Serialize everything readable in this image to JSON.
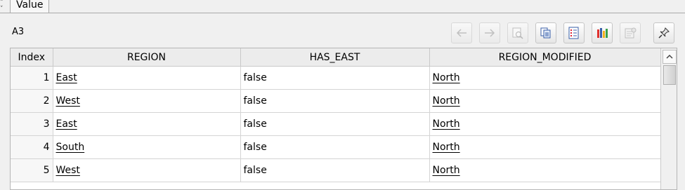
{
  "tab": {
    "label": "Value"
  },
  "cell_ref": "A3",
  "toolbar": {
    "buttons": [
      {
        "icon": "arrow-left-icon",
        "enabled": false
      },
      {
        "icon": "arrow-right-icon",
        "enabled": false
      },
      {
        "icon": "zoom-icon",
        "enabled": false
      },
      {
        "icon": "copy-icon",
        "enabled": true
      },
      {
        "icon": "list-icon",
        "enabled": true
      },
      {
        "icon": "bar-chart-icon",
        "enabled": true
      },
      {
        "icon": "settings-icon",
        "enabled": false
      },
      {
        "icon": "pin-icon",
        "enabled": true
      }
    ]
  },
  "table": {
    "columns": [
      "Index",
      "REGION",
      "HAS_EAST",
      "REGION_MODIFIED"
    ],
    "rows": [
      {
        "index": "1",
        "region": "East",
        "has_east": "false",
        "region_modified": "North"
      },
      {
        "index": "2",
        "region": "West",
        "has_east": "false",
        "region_modified": "North"
      },
      {
        "index": "3",
        "region": "East",
        "has_east": "false",
        "region_modified": "North"
      },
      {
        "index": "4",
        "region": "South",
        "has_east": "false",
        "region_modified": "North"
      },
      {
        "index": "5",
        "region": "West",
        "has_east": "false",
        "region_modified": "North"
      }
    ]
  }
}
